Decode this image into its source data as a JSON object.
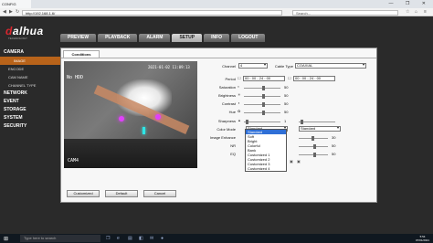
{
  "browser": {
    "tab_title": "CONFIG",
    "url": "http://192.168.1.6/",
    "search_placeholder": "Search...",
    "window_buttons": "— ❐ ✕"
  },
  "brand": {
    "logo_main": "alhua",
    "logo_prefix": "d",
    "tagline": "TECHNOLOGY"
  },
  "main_nav": [
    {
      "label": "PREVIEW"
    },
    {
      "label": "PLAYBACK"
    },
    {
      "label": "ALARM"
    },
    {
      "label": "SETUP",
      "active": true
    },
    {
      "label": "INFO"
    },
    {
      "label": "LOGOUT"
    }
  ],
  "sidebar": {
    "camera": "CAMERA",
    "image": "IMAGE",
    "encode": "ENCODE",
    "cam_name": "CAM NAME",
    "channel_type": "CHANNEL TYPE",
    "network": "NETWORK",
    "event": "EVENT",
    "storage": "STORAGE",
    "system": "SYSTEM",
    "security": "SECURITY"
  },
  "panel": {
    "tab": "Conditions",
    "video": {
      "osd_name": "No HDD",
      "osd_time": "2021-01-02 11:09:13",
      "osd_cam": "CAM4"
    },
    "buttons": {
      "customized": "Customized",
      "default": "Default",
      "cancel": "Cancel"
    },
    "fields": {
      "channel_label": "Channel",
      "channel_value": "4",
      "cable_type_label": "Cable Type",
      "cable_type_value": "COAXIAL",
      "period_label": "Period",
      "period_start_1": "00 : 00 - 24 : 00",
      "period_start_2": "00 : 00 - 24 : 00",
      "saturation_label": "Saturation",
      "saturation_value": "50",
      "brightness_label": "Brightness",
      "brightness_value": "50",
      "contrast_label": "Contrast",
      "contrast_value": "50",
      "hue_label": "Hue",
      "hue_value": "50",
      "sharpness_label": "Sharpness",
      "sharpness_value": "1",
      "color_mode_label": "Color Mode",
      "color_mode_value": "Standard",
      "color_mode_value_2": "Standard",
      "image_enhance_label": "Image Enhance",
      "image_enhance_value": "30",
      "nr_label": "NR",
      "nr_value": "50",
      "eq_label": "EQ",
      "eq_value": "50"
    },
    "color_mode_options": [
      "Standard",
      "Soft",
      "Bright",
      "Colorful",
      "Bank",
      "Customized 1",
      "Customized 2",
      "Customized 3",
      "Customized 4"
    ],
    "color_mode_selected_index": 0
  },
  "taskbar": {
    "search_placeholder": "Type here to search",
    "time": "5:54",
    "date": "07/01/2021"
  }
}
